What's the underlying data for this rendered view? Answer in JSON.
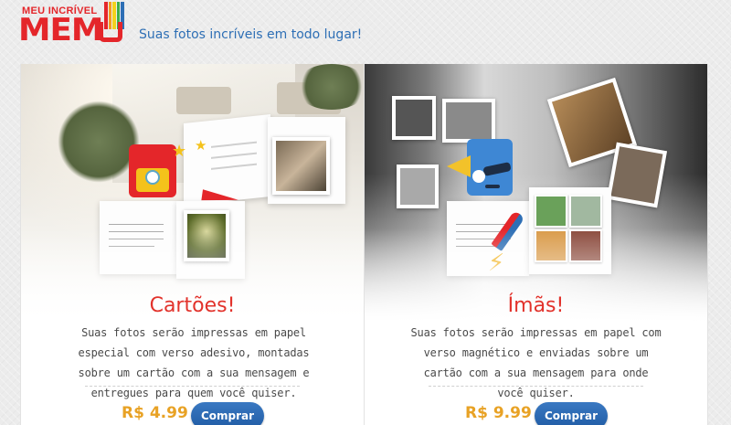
{
  "header": {
    "logo_top": "MEU INCRÍVEL",
    "logo_main": "MEM",
    "tagline": "Suas fotos incríveis em todo lugar!"
  },
  "products": [
    {
      "title": "Cartões!",
      "description": "Suas fotos serão impressas em papel especial com verso adesivo, montadas sobre um cartão com a sua mensagem e entregues para quem você quiser.",
      "price": "R$ 4.99",
      "button": "Comprar"
    },
    {
      "title": "Ímãs!",
      "description": "Suas fotos serão impressas em papel com verso magnético e enviadas sobre um cartão com a sua mensagem para onde você quiser.",
      "price": "R$ 9.99",
      "button": "Comprar"
    }
  ],
  "icons": [
    "star-icon",
    "magnet-icon",
    "lightning-icon"
  ],
  "colors": {
    "brand_red": "#e4262a",
    "tagline_blue": "#2e6fb5",
    "price_orange": "#e8a225",
    "button_blue": "#1f5ba3"
  }
}
